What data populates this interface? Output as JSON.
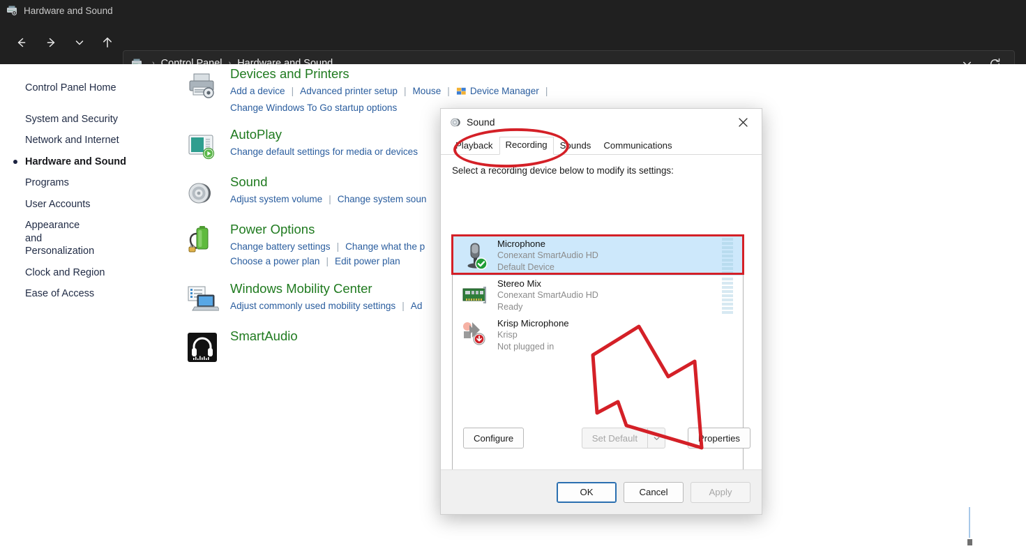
{
  "window": {
    "title": "Hardware and Sound",
    "title_icon": "devices-printers-icon"
  },
  "nav": {
    "back_icon": "arrow-left-icon",
    "forward_icon": "arrow-right-icon",
    "recent_icon": "chevron-down-icon",
    "up_icon": "arrow-up-icon",
    "address_icon": "devices-printers-icon",
    "breadcrumbs": [
      "Control Panel",
      "Hardware and Sound"
    ],
    "separator": "›",
    "history_icon": "chevron-down-icon",
    "refresh_icon": "refresh-icon"
  },
  "sidebar": {
    "home": "Control Panel Home",
    "items": [
      {
        "label": "System and Security",
        "current": false
      },
      {
        "label": "Network and Internet",
        "current": false
      },
      {
        "label": "Hardware and Sound",
        "current": true
      },
      {
        "label": "Programs",
        "current": false
      },
      {
        "label": "User Accounts",
        "current": false
      },
      {
        "label": "Appearance and Personalization",
        "current": false
      },
      {
        "label": "Clock and Region",
        "current": false
      },
      {
        "label": "Ease of Access",
        "current": false
      }
    ]
  },
  "categories": [
    {
      "title": "Devices and Printers",
      "icon": "printer-icon",
      "rows": [
        [
          "Add a device",
          "Advanced printer setup",
          "Mouse",
          "Device Manager",
          ""
        ],
        [
          "Change Windows To Go startup options"
        ]
      ]
    },
    {
      "title": "AutoPlay",
      "icon": "autoplay-icon",
      "rows": [
        [
          "Change default settings for media or devices"
        ]
      ]
    },
    {
      "title": "Sound",
      "icon": "speaker-icon",
      "rows": [
        [
          "Adjust system volume",
          "Change system soun"
        ]
      ]
    },
    {
      "title": "Power Options",
      "icon": "battery-icon",
      "rows": [
        [
          "Change battery settings",
          "Change what the p"
        ],
        [
          "Choose a power plan",
          "Edit power plan"
        ]
      ]
    },
    {
      "title": "Windows Mobility Center",
      "icon": "mobility-center-icon",
      "rows": [
        [
          "Adjust commonly used mobility settings",
          "Ad"
        ]
      ]
    },
    {
      "title": "SmartAudio",
      "icon": "smartaudio-icon",
      "rows": []
    }
  ],
  "dialog": {
    "title": "Sound",
    "title_icon": "speaker-icon",
    "close_icon": "close-icon",
    "tabs": [
      {
        "label": "Playback",
        "active": false
      },
      {
        "label": "Recording",
        "active": true
      },
      {
        "label": "Sounds",
        "active": false
      },
      {
        "label": "Communications",
        "active": false
      }
    ],
    "instruction": "Select a recording device below to modify its settings:",
    "devices": [
      {
        "name": "Microphone",
        "driver": "Conexant SmartAudio HD",
        "status": "Default Device",
        "icon": "microphone-icon",
        "badge": "check-badge-icon",
        "selected": true,
        "meter_level": 9
      },
      {
        "name": "Stereo Mix",
        "driver": "Conexant SmartAudio HD",
        "status": "Ready",
        "icon": "sound-card-icon",
        "badge": "",
        "selected": false,
        "meter_level": 0
      },
      {
        "name": "Krisp Microphone",
        "driver": "Krisp",
        "status": "Not plugged in",
        "icon": "krisp-icon",
        "badge": "disabled-badge-icon",
        "selected": false,
        "meter_level": 0
      }
    ],
    "buttons": {
      "configure": "Configure",
      "set_default": "Set Default",
      "set_default_arrow_icon": "chevron-down-icon",
      "properties": "Properties",
      "ok": "OK",
      "cancel": "Cancel",
      "apply": "Apply"
    }
  },
  "annotations": {
    "ellipse_target": "recording-tab",
    "arrow_target": "properties-button",
    "color": "#d42027"
  }
}
